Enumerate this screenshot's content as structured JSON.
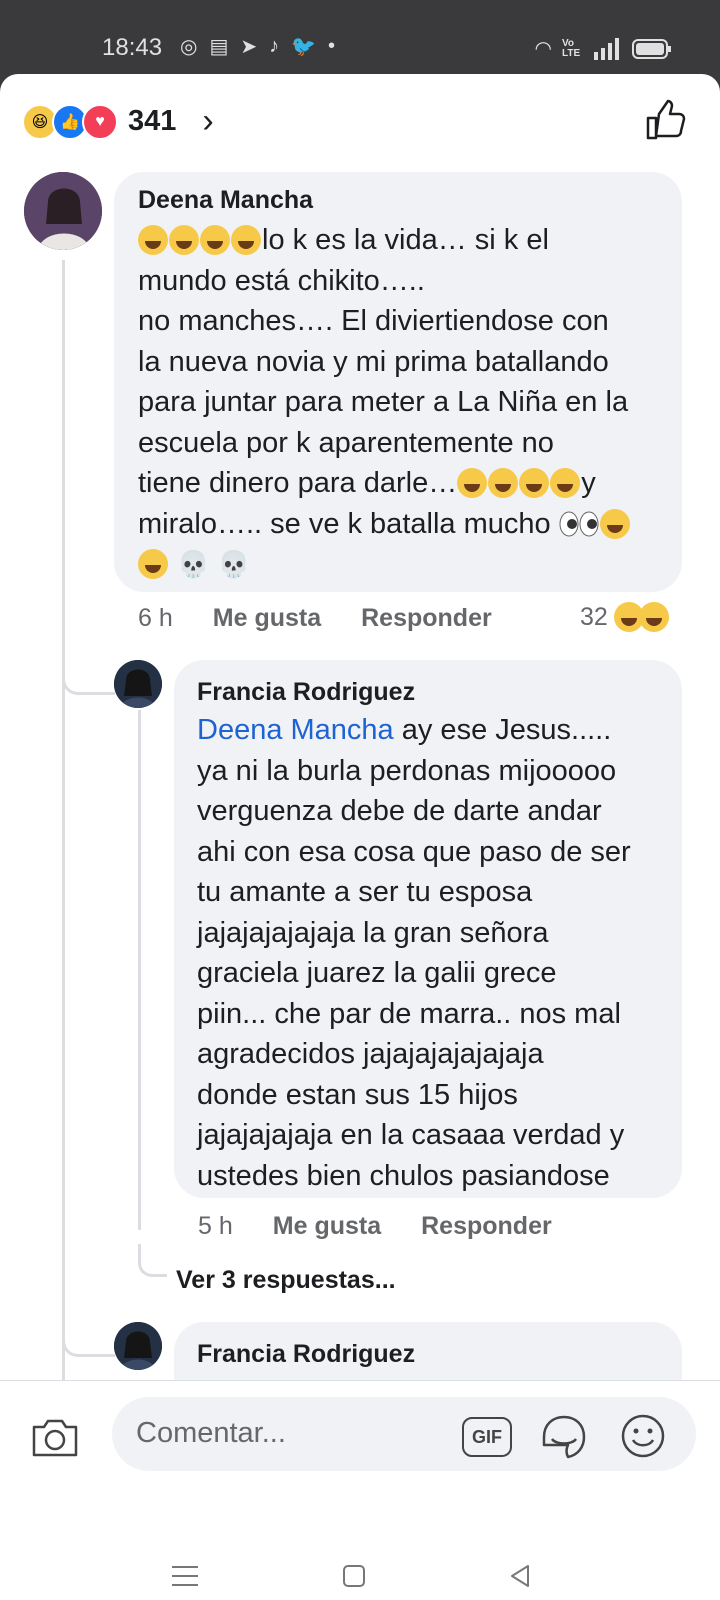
{
  "status_bar": {
    "time": "18:43",
    "network": "Vo LTE"
  },
  "header": {
    "reaction_count": "341"
  },
  "comments": [
    {
      "author": "Deena Mancha",
      "text_lines": [
        "lo k es la vida… si k el",
        "mundo está chikito…..",
        "no manches…. El diviertiendose con",
        "la nueva novia y mi prima batallando",
        "para juntar para meter a La Niña en la",
        "escuela por k aparentemente no",
        "tiene dinero para darle…",
        "y",
        "miralo….. se ve k batalla mucho"
      ],
      "time": "6 h",
      "like_label": "Me gusta",
      "reply_label": "Responder",
      "reaction_count": "32"
    },
    {
      "author": "Francia Rodriguez",
      "mention": "Deena Mancha",
      "text_lines": [
        "ay ese Jesus.....",
        "ya ni la burla perdonas mijooooo",
        "verguenza debe de darte andar",
        "ahi con esa cosa que paso de ser",
        "tu amante a ser tu esposa",
        "jajajajajajaja la gran señora",
        "graciela juarez la galii grece",
        "piin... che par de marra.. nos mal",
        "agradecidos jajajajajajajaja",
        "donde estan sus 15 hijos",
        "jajajajajaja en la casaaa verdad y",
        "ustedes bien chulos pasiandose"
      ],
      "time": "5 h",
      "like_label": "Me gusta",
      "reply_label": "Responder",
      "view_replies": "Ver 3 respuestas..."
    },
    {
      "author": "Francia Rodriguez"
    }
  ],
  "composer": {
    "placeholder": "Comentar...",
    "gif_label": "GIF"
  }
}
